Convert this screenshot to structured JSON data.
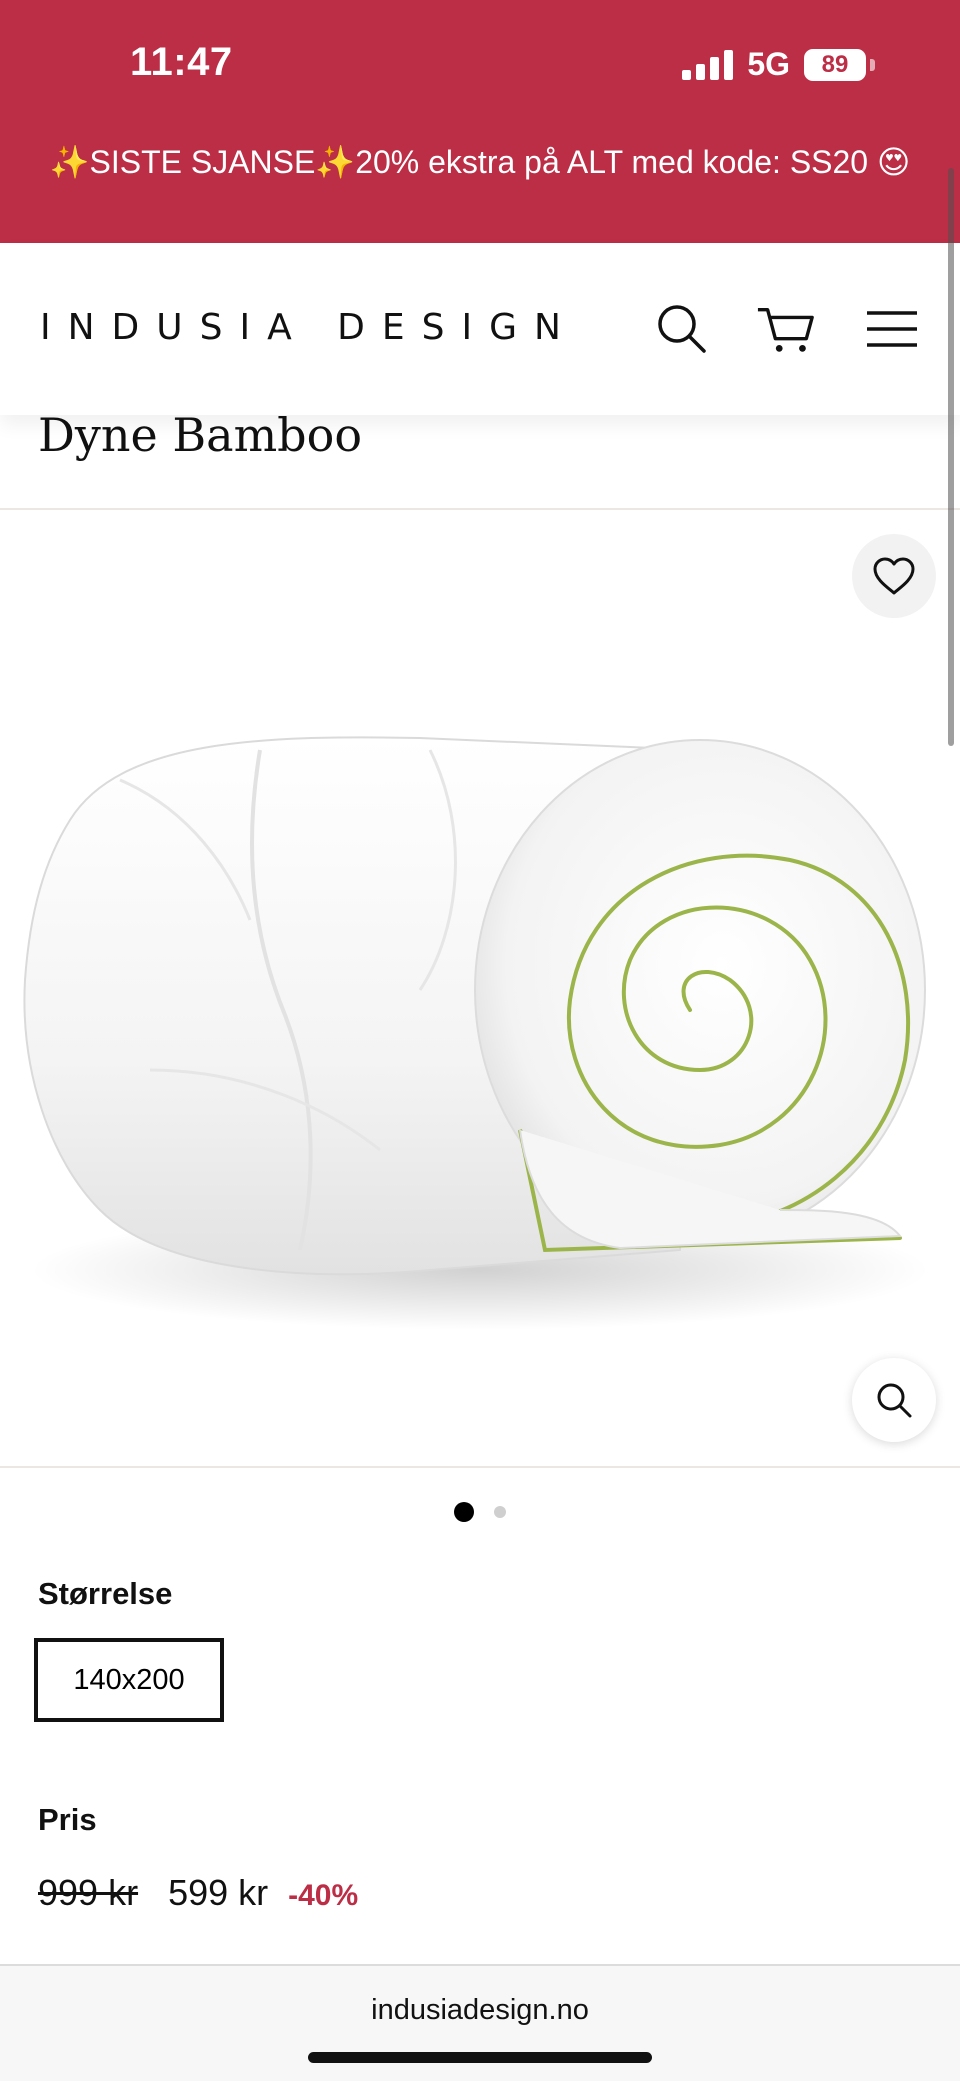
{
  "status_bar": {
    "time": "11:47",
    "network": "5G",
    "battery": "89"
  },
  "announcement": {
    "text": "✨SISTE SJANSE✨20% ekstra på ALT med kode: SS20 😍"
  },
  "header": {
    "logo": "INDUSIA DESIGN",
    "icons": [
      "search-icon",
      "cart-icon",
      "menu-icon"
    ]
  },
  "product": {
    "title": "Dyne Bamboo",
    "gallery": {
      "image_count": 2,
      "active_index": 0
    },
    "size": {
      "label": "Størrelse",
      "selected": "140x200"
    },
    "price": {
      "label": "Pris",
      "original": "999 kr",
      "current": "599 kr",
      "discount": "-40%"
    }
  },
  "browser": {
    "url": "indusiadesign.no"
  },
  "colors": {
    "brand_red": "#bc2d46",
    "text": "#111111",
    "piping_green": "#9bb54a"
  }
}
